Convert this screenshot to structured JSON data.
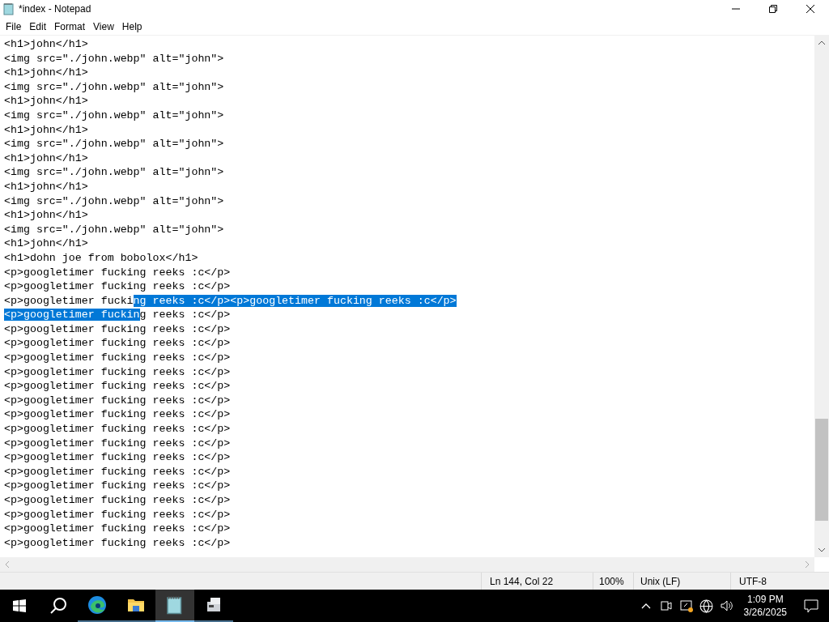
{
  "window": {
    "title": "*index - Notepad"
  },
  "menu": [
    "File",
    "Edit",
    "Format",
    "View",
    "Help"
  ],
  "lines": [
    {
      "segments": [
        {
          "text": "<h1>john</h1>",
          "selected": false
        }
      ]
    },
    {
      "segments": [
        {
          "text": "<img src=\"./john.webp\" alt=\"john\">",
          "selected": false
        }
      ]
    },
    {
      "segments": [
        {
          "text": "<h1>john</h1>",
          "selected": false
        }
      ]
    },
    {
      "segments": [
        {
          "text": "<img src=\"./john.webp\" alt=\"john\">",
          "selected": false
        }
      ]
    },
    {
      "segments": [
        {
          "text": "<h1>john</h1>",
          "selected": false
        }
      ]
    },
    {
      "segments": [
        {
          "text": "<img src=\"./john.webp\" alt=\"john\">",
          "selected": false
        }
      ]
    },
    {
      "segments": [
        {
          "text": "<h1>john</h1>",
          "selected": false
        }
      ]
    },
    {
      "segments": [
        {
          "text": "<img src=\"./john.webp\" alt=\"john\">",
          "selected": false
        }
      ]
    },
    {
      "segments": [
        {
          "text": "<h1>john</h1>",
          "selected": false
        }
      ]
    },
    {
      "segments": [
        {
          "text": "<img src=\"./john.webp\" alt=\"john\">",
          "selected": false
        }
      ]
    },
    {
      "segments": [
        {
          "text": "<h1>john</h1>",
          "selected": false
        }
      ]
    },
    {
      "segments": [
        {
          "text": "<img src=\"./john.webp\" alt=\"john\">",
          "selected": false
        }
      ]
    },
    {
      "segments": [
        {
          "text": "<h1>john</h1>",
          "selected": false
        }
      ]
    },
    {
      "segments": [
        {
          "text": "<img src=\"./john.webp\" alt=\"john\">",
          "selected": false
        }
      ]
    },
    {
      "segments": [
        {
          "text": "<h1>john</h1>",
          "selected": false
        }
      ]
    },
    {
      "segments": [
        {
          "text": "<h1>dohn joe from bobolox</h1>",
          "selected": false
        }
      ]
    },
    {
      "segments": [
        {
          "text": "<p>googletimer fucking reeks :c</p>",
          "selected": false
        }
      ]
    },
    {
      "segments": [
        {
          "text": "<p>googletimer fucking reeks :c</p>",
          "selected": false
        }
      ]
    },
    {
      "segments": [
        {
          "text": "<p>googletimer fucki",
          "selected": false
        },
        {
          "text": "ng reeks :c</p><p>googletimer fucking reeks :c</p>",
          "selected": true
        }
      ]
    },
    {
      "segments": [
        {
          "text": "<p>googletimer fuckin",
          "selected": true
        },
        {
          "text": "g reeks :c</p>",
          "selected": false
        }
      ]
    },
    {
      "segments": [
        {
          "text": "<p>googletimer fucking reeks :c</p>",
          "selected": false
        }
      ]
    },
    {
      "segments": [
        {
          "text": "<p>googletimer fucking reeks :c</p>",
          "selected": false
        }
      ]
    },
    {
      "segments": [
        {
          "text": "<p>googletimer fucking reeks :c</p>",
          "selected": false
        }
      ]
    },
    {
      "segments": [
        {
          "text": "<p>googletimer fucking reeks :c</p>",
          "selected": false
        }
      ]
    },
    {
      "segments": [
        {
          "text": "<p>googletimer fucking reeks :c</p>",
          "selected": false
        }
      ]
    },
    {
      "segments": [
        {
          "text": "<p>googletimer fucking reeks :c</p>",
          "selected": false
        }
      ]
    },
    {
      "segments": [
        {
          "text": "<p>googletimer fucking reeks :c</p>",
          "selected": false
        }
      ]
    },
    {
      "segments": [
        {
          "text": "<p>googletimer fucking reeks :c</p>",
          "selected": false
        }
      ]
    },
    {
      "segments": [
        {
          "text": "<p>googletimer fucking reeks :c</p>",
          "selected": false
        }
      ]
    },
    {
      "segments": [
        {
          "text": "<p>googletimer fucking reeks :c</p>",
          "selected": false
        }
      ]
    },
    {
      "segments": [
        {
          "text": "<p>googletimer fucking reeks :c</p>",
          "selected": false
        }
      ]
    },
    {
      "segments": [
        {
          "text": "<p>googletimer fucking reeks :c</p>",
          "selected": false
        }
      ]
    },
    {
      "segments": [
        {
          "text": "<p>googletimer fucking reeks :c</p>",
          "selected": false
        }
      ]
    },
    {
      "segments": [
        {
          "text": "<p>googletimer fucking reeks :c</p>",
          "selected": false
        }
      ]
    },
    {
      "segments": [
        {
          "text": "<p>googletimer fucking reeks :c</p>",
          "selected": false
        }
      ]
    },
    {
      "segments": [
        {
          "text": "<p>googletimer fucking reeks :c</p>",
          "selected": false
        }
      ]
    }
  ],
  "status_bar": {
    "position": "Ln 144, Col 22",
    "zoom": "100%",
    "line_ending": "Unix (LF)",
    "encoding": "UTF-8"
  },
  "taskbar": {
    "apps": [
      {
        "kind": "edge",
        "selected": false
      },
      {
        "kind": "folder",
        "selected": false
      },
      {
        "kind": "notepad",
        "selected": true
      },
      {
        "kind": "app",
        "selected": false
      }
    ],
    "time": "1:09 PM",
    "date": "3/26/2025"
  }
}
